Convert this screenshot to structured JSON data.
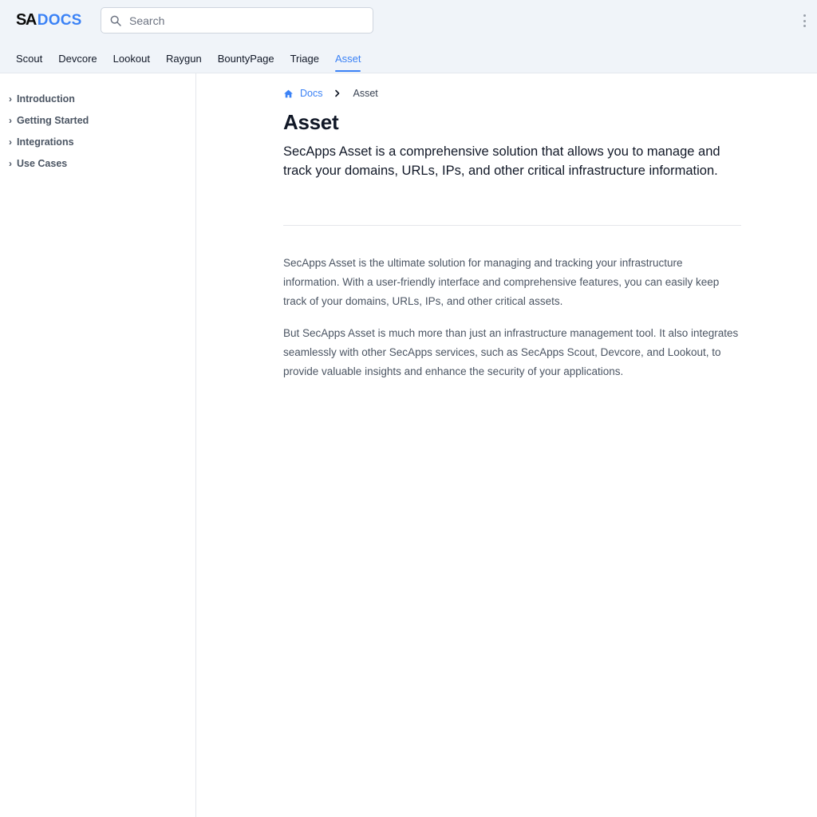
{
  "header": {
    "logo_sa": "SA",
    "logo_docs": "DOCS",
    "search_placeholder": "Search"
  },
  "tabs": [
    {
      "label": "Scout"
    },
    {
      "label": "Devcore"
    },
    {
      "label": "Lookout"
    },
    {
      "label": "Raygun"
    },
    {
      "label": "BountyPage"
    },
    {
      "label": "Triage"
    },
    {
      "label": "Asset",
      "active": true
    }
  ],
  "sidebar": {
    "items": [
      {
        "label": "Introduction"
      },
      {
        "label": "Getting Started"
      },
      {
        "label": "Integrations"
      },
      {
        "label": "Use Cases"
      }
    ]
  },
  "breadcrumb": {
    "root": "Docs",
    "current": "Asset"
  },
  "content": {
    "title": "Asset",
    "lead": "SecApps Asset is a comprehensive solution that allows you to manage and track your domains, URLs, IPs, and other critical infrastructure information.",
    "paragraphs": [
      "SecApps Asset is the ultimate solution for managing and tracking your infrastructure information. With a user-friendly interface and comprehensive features, you can easily keep track of your domains, URLs, IPs, and other critical assets.",
      "But SecApps Asset is much more than just an infrastructure management tool. It also integrates seamlessly with other SecApps services, such as SecApps Scout, Devcore, and Lookout, to provide valuable insights and enhance the security of your applications."
    ]
  },
  "colors": {
    "accent": "#3b82f6",
    "header_bg": "#f0f4f9"
  }
}
